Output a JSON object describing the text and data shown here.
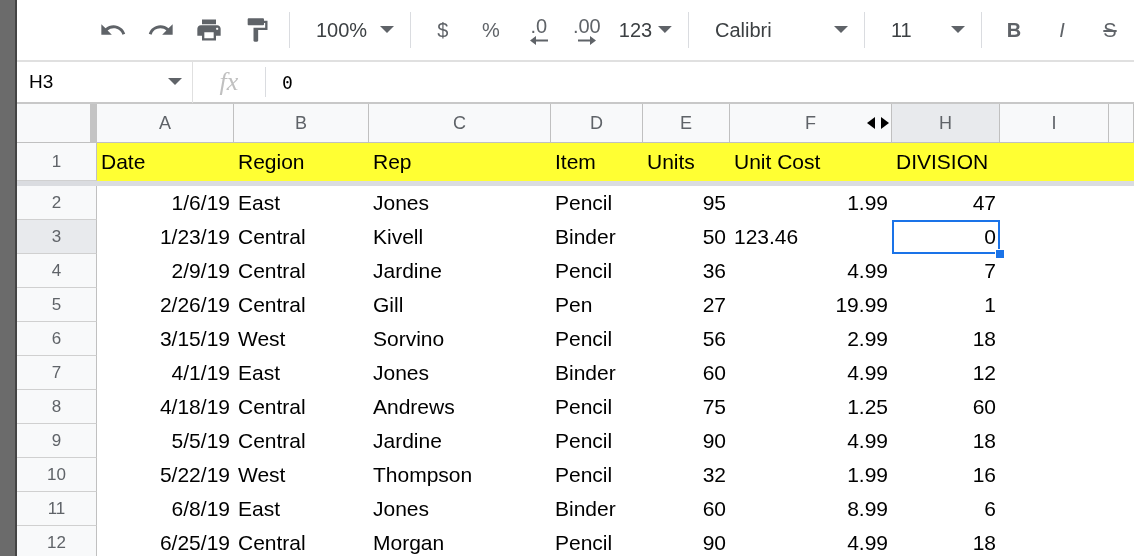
{
  "toolbar": [
    {
      "kind": "undo"
    },
    {
      "kind": "redo"
    },
    {
      "kind": "print"
    },
    {
      "kind": "paint"
    },
    {
      "kind": "sep"
    },
    {
      "kind": "zoom",
      "label": "100%"
    },
    {
      "kind": "sep"
    },
    {
      "kind": "text",
      "label": "$"
    },
    {
      "kind": "text",
      "label": "%"
    },
    {
      "kind": "decrease",
      "label": ".0"
    },
    {
      "kind": "increase",
      "label": ".00"
    },
    {
      "kind": "numformat",
      "label": "123"
    },
    {
      "kind": "sep"
    },
    {
      "kind": "font",
      "label": "Calibri"
    },
    {
      "kind": "sep"
    },
    {
      "kind": "fontsize",
      "label": "11"
    },
    {
      "kind": "sep"
    },
    {
      "kind": "bold",
      "label": "B"
    },
    {
      "kind": "italic",
      "label": "I"
    },
    {
      "kind": "strike",
      "label": "S"
    }
  ],
  "formula_bar": {
    "name_box": "H3",
    "fx_label": "fx",
    "value": "0"
  },
  "columns": [
    {
      "label": "A",
      "selected": false
    },
    {
      "label": "B",
      "selected": false
    },
    {
      "label": "C",
      "selected": false
    },
    {
      "label": "D",
      "selected": false
    },
    {
      "label": "E",
      "selected": false
    },
    {
      "label": "F",
      "selected": false,
      "hidden_after": true
    },
    {
      "label": "H",
      "selected": true
    },
    {
      "label": "I",
      "selected": false
    }
  ],
  "rows": [
    {
      "number": "1",
      "selected": false,
      "header": true,
      "cells": [
        "Date",
        "Region",
        "Rep",
        "Item",
        "Units",
        "Unit Cost",
        "DIVISION",
        ""
      ]
    },
    {
      "number": "2",
      "selected": false,
      "cells": [
        "1/6/19",
        "East",
        "Jones",
        "Pencil",
        "95",
        "1.99",
        "47",
        ""
      ]
    },
    {
      "number": "3",
      "selected": true,
      "cells": [
        "1/23/19",
        "Central",
        "Kivell",
        "Binder",
        "50",
        {
          "text": "123.46",
          "left_aligned": true
        },
        "0",
        ""
      ]
    },
    {
      "number": "4",
      "selected": false,
      "cells": [
        "2/9/19",
        "Central",
        "Jardine",
        "Pencil",
        "36",
        "4.99",
        "7",
        ""
      ]
    },
    {
      "number": "5",
      "selected": false,
      "cells": [
        "2/26/19",
        "Central",
        "Gill",
        "Pen",
        "27",
        "19.99",
        "1",
        ""
      ]
    },
    {
      "number": "6",
      "selected": false,
      "cells": [
        "3/15/19",
        "West",
        "Sorvino",
        "Pencil",
        "56",
        "2.99",
        "18",
        ""
      ]
    },
    {
      "number": "7",
      "selected": false,
      "cells": [
        "4/1/19",
        "East",
        "Jones",
        "Binder",
        "60",
        "4.99",
        "12",
        ""
      ]
    },
    {
      "number": "8",
      "selected": false,
      "cells": [
        "4/18/19",
        "Central",
        "Andrews",
        "Pencil",
        "75",
        "1.25",
        "60",
        ""
      ]
    },
    {
      "number": "9",
      "selected": false,
      "cells": [
        "5/5/19",
        "Central",
        "Jardine",
        "Pencil",
        "90",
        "4.99",
        "18",
        ""
      ]
    },
    {
      "number": "10",
      "selected": false,
      "cells": [
        "5/22/19",
        "West",
        "Thompson",
        "Pencil",
        "32",
        "1.99",
        "16",
        ""
      ]
    },
    {
      "number": "11",
      "selected": false,
      "cells": [
        "6/8/19",
        "East",
        "Jones",
        "Binder",
        "60",
        "8.99",
        "6",
        ""
      ]
    },
    {
      "number": "12",
      "selected": false,
      "cells": [
        "6/25/19",
        "Central",
        "Morgan",
        "Pencil",
        "90",
        "4.99",
        "18",
        ""
      ]
    }
  ]
}
